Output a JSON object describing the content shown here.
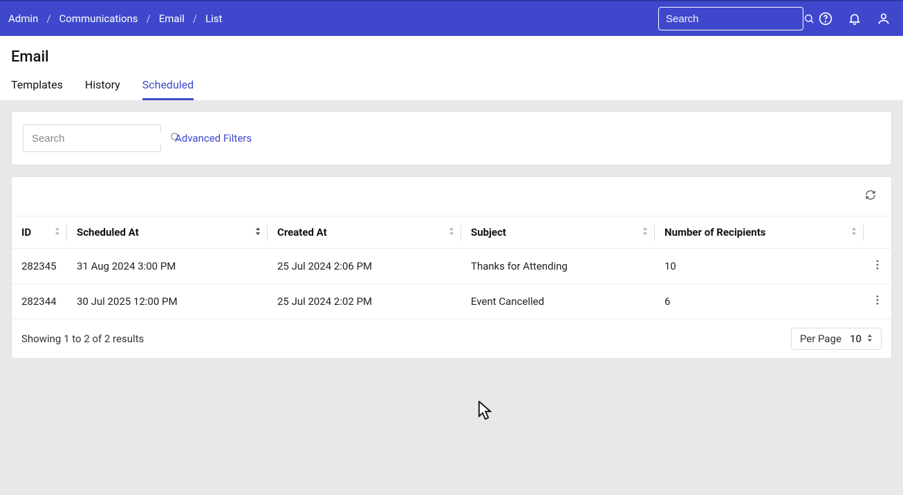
{
  "header": {
    "breadcrumbs": [
      "Admin",
      "Communications",
      "Email",
      "List"
    ],
    "search_placeholder": "Search"
  },
  "page": {
    "title": "Email",
    "tabs": [
      {
        "label": "Templates",
        "active": false
      },
      {
        "label": "History",
        "active": false
      },
      {
        "label": "Scheduled",
        "active": true
      }
    ]
  },
  "filter": {
    "search_placeholder": "Search",
    "advanced_filters_label": "Advanced Filters"
  },
  "table": {
    "columns": [
      {
        "key": "id",
        "label": "ID",
        "sortable": true
      },
      {
        "key": "scheduled_at",
        "label": "Scheduled At",
        "sortable": true,
        "sorted": true
      },
      {
        "key": "created_at",
        "label": "Created At",
        "sortable": true
      },
      {
        "key": "subject",
        "label": "Subject",
        "sortable": true
      },
      {
        "key": "recipients",
        "label": "Number of Recipients",
        "sortable": true
      }
    ],
    "rows": [
      {
        "id": "282345",
        "scheduled_at": "31 Aug 2024 3:00 PM",
        "created_at": "25 Jul 2024 2:06 PM",
        "subject": "Thanks for Attending",
        "recipients": "10"
      },
      {
        "id": "282344",
        "scheduled_at": "30 Jul 2025 12:00 PM",
        "created_at": "25 Jul 2024 2:02 PM",
        "subject": "Event Cancelled",
        "recipients": "6"
      }
    ],
    "footer": {
      "summary": "Showing 1 to 2 of 2 results",
      "per_page_label": "Per Page",
      "per_page_value": "10"
    }
  }
}
